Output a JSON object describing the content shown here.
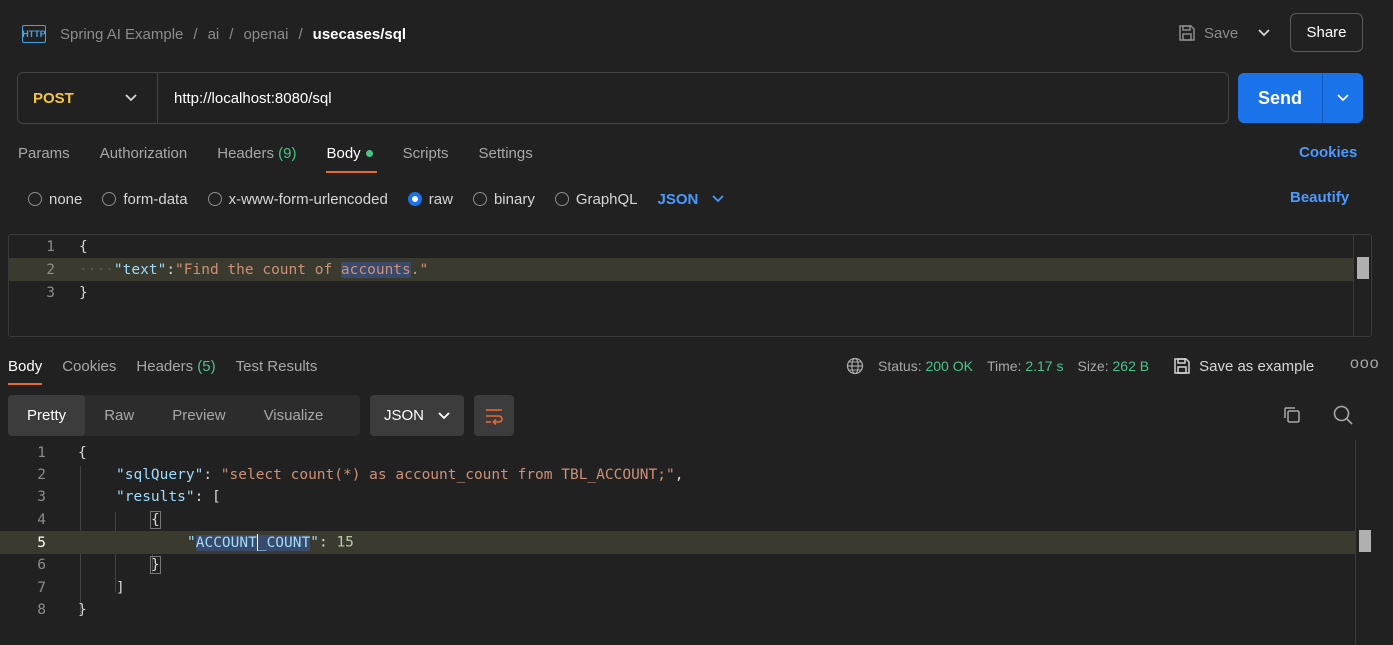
{
  "breadcrumb": {
    "icon": "HTTP",
    "items": [
      "Spring AI Example",
      "ai",
      "openai"
    ],
    "separator": "/",
    "current": "usecases/sql"
  },
  "toolbar": {
    "save_label": "Save",
    "share_label": "Share"
  },
  "request": {
    "method": "POST",
    "url": "http://localhost:8080/sql",
    "send_label": "Send"
  },
  "request_tabs": {
    "params": "Params",
    "authorization": "Authorization",
    "headers": "Headers",
    "headers_count": "(9)",
    "body": "Body",
    "scripts": "Scripts",
    "settings": "Settings",
    "cookies": "Cookies"
  },
  "body_types": {
    "none": "none",
    "form_data": "form-data",
    "urlencoded": "x-www-form-urlencoded",
    "raw": "raw",
    "binary": "binary",
    "graphql": "GraphQL",
    "format": "JSON",
    "beautify": "Beautify"
  },
  "request_body": {
    "lines": [
      {
        "n": "1",
        "open": "{"
      },
      {
        "n": "2",
        "key": "\"text\"",
        "colon": ":",
        "value_a": "\"Find the count of ",
        "value_sel": "accounts",
        "value_b": ".\""
      },
      {
        "n": "3",
        "close": "}"
      }
    ]
  },
  "response_tabs": {
    "body": "Body",
    "cookies": "Cookies",
    "headers": "Headers",
    "headers_count": "(5)",
    "test_results": "Test Results"
  },
  "response_status": {
    "status_label": "Status:",
    "status_value": "200 OK",
    "time_label": "Time:",
    "time_value": "2.17 s",
    "size_label": "Size:",
    "size_value": "262 B",
    "save_example": "Save as example",
    "more": "ooo"
  },
  "response_views": {
    "pretty": "Pretty",
    "raw": "Raw",
    "preview": "Preview",
    "visualize": "Visualize",
    "format": "JSON"
  },
  "response_body": {
    "line_numbers": [
      "1",
      "2",
      "3",
      "4",
      "5",
      "6",
      "7",
      "8"
    ],
    "l1": "{",
    "l2_key": "\"sqlQuery\"",
    "l2_colon": ": ",
    "l2_value": "\"select count(*) as account_count from TBL_ACCOUNT;\"",
    "l2_comma": ",",
    "l3_key": "\"results\"",
    "l3_rest": ": [",
    "l4": "{",
    "l5_quote_open": "\"",
    "l5_key_a": "ACCOUNT",
    "l5_key_b": "_COUNT",
    "l5_quote_close": "\"",
    "l5_colon": ": ",
    "l5_value": "15",
    "l6": "}",
    "l7": "]",
    "l8": "}"
  },
  "colors": {
    "accent_orange": "#e86a33",
    "send_blue": "#1a73e8",
    "link_blue": "#4c9aff",
    "method_yellow": "#f5c542",
    "success_green": "#4cc38a"
  }
}
